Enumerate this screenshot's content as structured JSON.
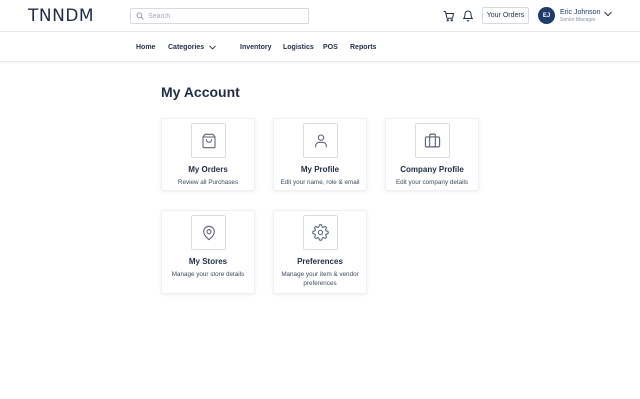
{
  "brand": {
    "logo_text": "TNNDM"
  },
  "search": {
    "placeholder": "Search"
  },
  "header": {
    "cart_icon": "cart-icon",
    "bell_icon": "bell-icon",
    "orders_button": "Your Orders",
    "user": {
      "initials": "EJ",
      "name": "Eric Johnson",
      "role": "Senior Manager"
    }
  },
  "nav": {
    "home": "Home",
    "categories": "Categories",
    "inventory": "Inventory",
    "logistics": "Logistics",
    "pos": "POS",
    "reports": "Reports"
  },
  "page": {
    "title": "My Account"
  },
  "cards": [
    {
      "icon": "shopping-bag-icon",
      "title": "My Orders",
      "desc": "Review all Purchases"
    },
    {
      "icon": "user-icon",
      "title": "My Profile",
      "desc": "Edit your name, role & email"
    },
    {
      "icon": "briefcase-icon",
      "title": "Company Profile",
      "desc": "Edit your company details"
    },
    {
      "icon": "location-pin-icon",
      "title": "My Stores",
      "desc": "Manage your store details"
    },
    {
      "icon": "gear-icon",
      "title": "Preferences",
      "desc": "Manage your item & vendor preferences"
    }
  ]
}
